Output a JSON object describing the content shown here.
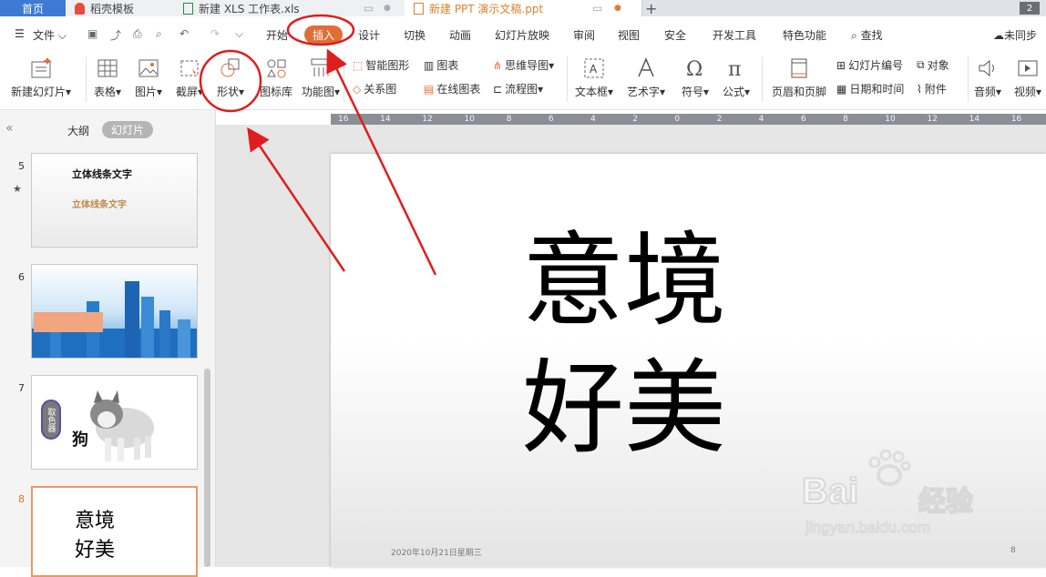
{
  "tabs": {
    "home": "首页",
    "template": "稻壳模板",
    "xls": "新建 XLS 工作表.xls",
    "ppt": "新建 PPT 演示文稿.ppt",
    "add": "+",
    "window_count": "2"
  },
  "menu": {
    "file": "文件",
    "items": [
      "开始",
      "插入",
      "设计",
      "切换",
      "动画",
      "幻灯片放映",
      "审阅",
      "视图",
      "安全",
      "开发工具",
      "特色功能"
    ],
    "search": "查找",
    "sync": "未同步"
  },
  "ribbon": {
    "new_slide": "新建幻灯片",
    "table": "表格",
    "picture": "图片",
    "screenshot": "截屏",
    "shape": "形状",
    "icon_lib": "图标库",
    "function_chart": "功能图",
    "smart_art": "智能图形",
    "chart": "图表",
    "relation": "关系图",
    "online_chart": "在线图表",
    "mindmap": "思维导图",
    "flowchart": "流程图",
    "textbox": "文本框",
    "art_text": "艺术字",
    "symbol": "符号",
    "formula": "公式",
    "header_footer": "页眉和页脚",
    "slide_number": "幻灯片编号",
    "date_time": "日期和时间",
    "object": "对象",
    "attachment": "附件",
    "audio": "音频",
    "video": "视频"
  },
  "panel": {
    "collapse": "«",
    "outline": "大纲",
    "slides": "幻灯片",
    "slide_numbers": [
      "5",
      "6",
      "7",
      "8"
    ],
    "slide5_title": "立体线条文字",
    "slide5_subtitle": "立体线条文字",
    "slide7_badge": "取色器",
    "slide7_text": "狗",
    "slide8_line1": "意境",
    "slide8_line2": "好美"
  },
  "ruler": [
    "16",
    "14",
    "12",
    "10",
    "8",
    "6",
    "4",
    "2",
    "0",
    "2",
    "4",
    "6",
    "8",
    "10",
    "12",
    "14",
    "16"
  ],
  "slide": {
    "line1": "意境",
    "line2": "好美",
    "date": "2020年10月21日星期三",
    "page_number": "8"
  },
  "watermark": {
    "brand": "Bai",
    "brand2": "经验",
    "url": "jingyan.baidu.com"
  },
  "colors": {
    "accent_insert": "#e06e36",
    "annotation_red": "#e01d1d",
    "home_tab": "#3d7ad6"
  }
}
